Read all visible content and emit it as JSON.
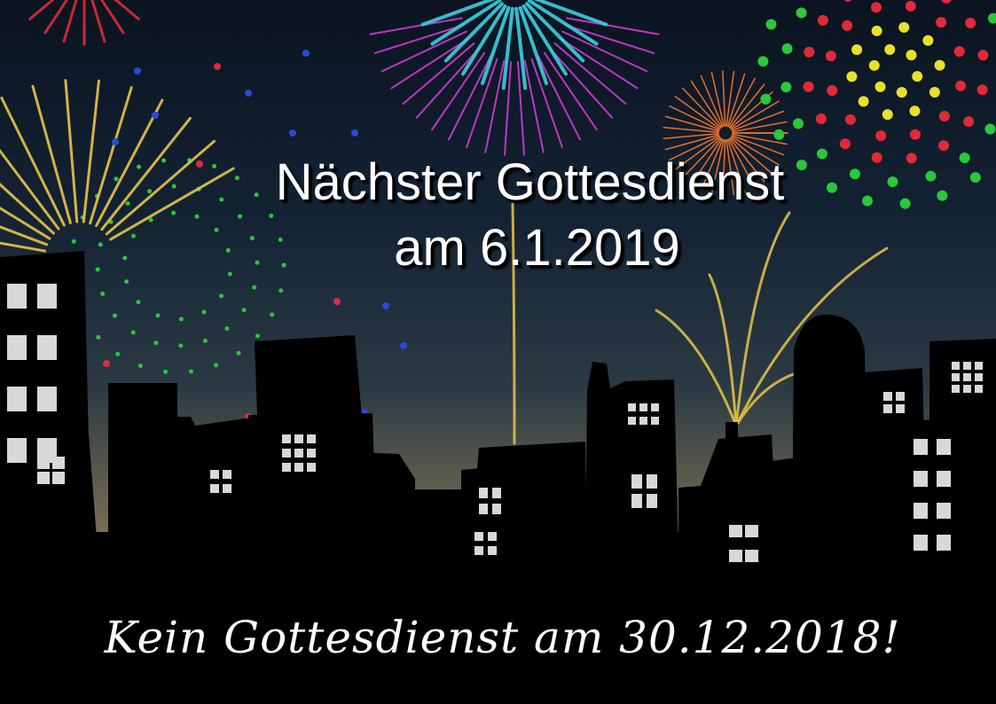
{
  "headline": {
    "line1": "Nächster Gottesdienst",
    "line2": "am 6.1.2019"
  },
  "notice": "Kein Gottesdienst am 30.12.2018!",
  "colors": {
    "sky_top": "#0b1420",
    "sky_glow": "#8a7a50",
    "silhouette": "#000000",
    "window": "#d8d8d8",
    "firework_gold": "#e8c44a",
    "firework_cyan": "#3ad0e0",
    "firework_magenta": "#d03ad8",
    "firework_orange": "#ff7a2a",
    "firework_red": "#e02a3a",
    "firework_green": "#2ac83a",
    "firework_yellow": "#e8e02a"
  }
}
